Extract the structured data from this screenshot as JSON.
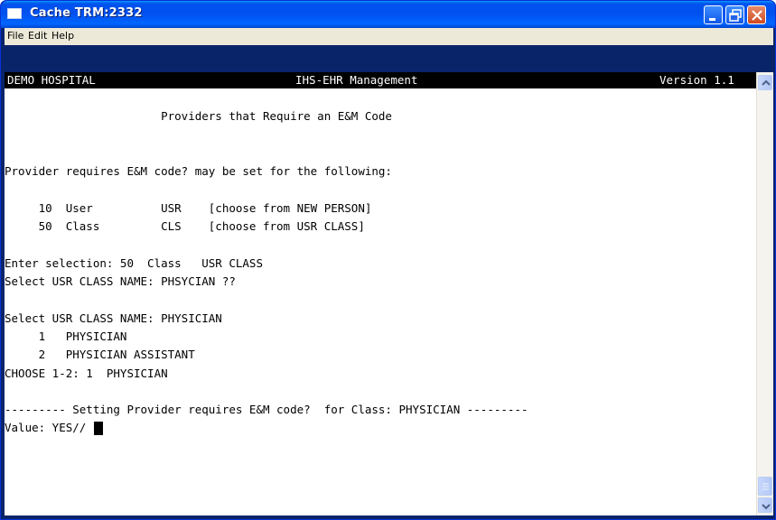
{
  "window": {
    "title": "Cache TRM:2332",
    "buttons": [
      "minimize",
      "maximize",
      "close"
    ]
  },
  "menu": [
    "File",
    "Edit",
    "Help"
  ],
  "status_bar": {
    "left": "DEMO HOSPITAL",
    "center": "IHS-EHR Management",
    "right": "Version 1.1"
  },
  "terminal": {
    "lines": [
      "",
      "                       Providers that Require an E&M Code",
      "",
      "",
      "Provider requires E&M code? may be set for the following:",
      "",
      "     10  User          USR    [choose from NEW PERSON]",
      "     50  Class         CLS    [choose from USR CLASS]",
      "",
      "Enter selection: 50  Class   USR CLASS",
      "Select USR CLASS NAME: PHSYCIAN ??",
      "",
      "Select USR CLASS NAME: PHYSICIAN",
      "     1   PHYSICIAN",
      "     2   PHYSICIAN ASSISTANT",
      "CHOOSE 1-2: 1  PHYSICIAN",
      "",
      "--------- Setting Provider requires E&M code?  for Class: PHYSICIAN ---------",
      "Value: YES// "
    ]
  },
  "icons": {
    "title_icon": "terminal-window-icon",
    "minimize": "minimize-icon",
    "maximize": "maximize-icon",
    "close": "close-icon",
    "scroll_up": "scroll-up-arrow-icon",
    "scroll_down": "scroll-down-arrow-icon"
  },
  "colors": {
    "titlebar": "#0054e3",
    "close_button": "#d04a20",
    "terminal_bg": "#ffffff",
    "status_bar_bg": "#000000",
    "menubar_bg": "#ece9d8"
  }
}
